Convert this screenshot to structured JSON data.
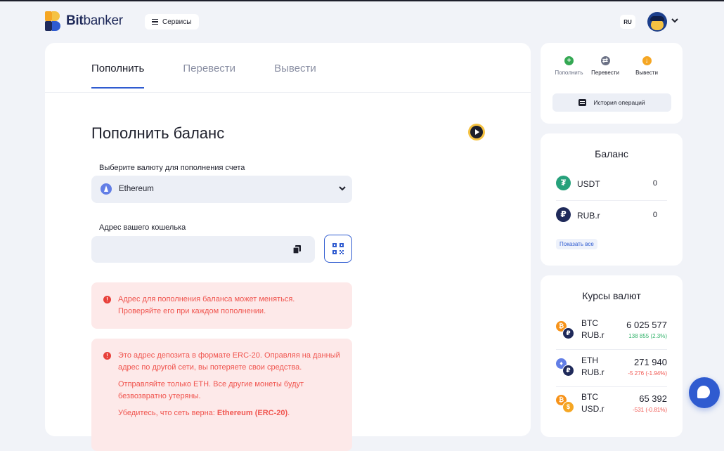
{
  "header": {
    "logo_text_bold": "Bit",
    "logo_text_rest": "banker",
    "services_label": "Сервисы",
    "language": "RU"
  },
  "tabs": [
    {
      "label": "Пополнить",
      "active": true
    },
    {
      "label": "Перевести",
      "active": false
    },
    {
      "label": "Вывести",
      "active": false
    }
  ],
  "deposit": {
    "title": "Пополнить баланс",
    "currency_label": "Выберите валюту для пополнения счета",
    "currency_value": "Ethereum",
    "wallet_label": "Адрес вашего кошелька",
    "wallet_value": ""
  },
  "alerts": {
    "first": {
      "line1": "Адрес для пополнения баланса может меняться.",
      "line2": "Проверяйте его при каждом пополнении."
    },
    "second": {
      "p1": "Это адрес депозита в формате ERC-20. Оправляя на данный адрес по другой сети, вы потеряете свои средства.",
      "p2": "Отправляйте только ETH. Все другие монеты будут безвозвратно утеряны.",
      "p3_prefix": "Убедитесь, что сеть верна: ",
      "p3_bold": "Ethereum (ERC-20)",
      "p3_suffix": "."
    }
  },
  "quick_actions": {
    "deposit": "Пополнить",
    "transfer": "Перевести",
    "withdraw": "Вывести",
    "history": "История операций"
  },
  "balance": {
    "title": "Баланс",
    "items": [
      {
        "name": "USDT",
        "amount": "0"
      },
      {
        "name": "RUB.r",
        "amount": "0"
      }
    ],
    "show_all": "Показать все"
  },
  "rates": {
    "title": "Курсы валют",
    "items": [
      {
        "base": "BTC",
        "quote": "RUB.r",
        "price": "6 025 577",
        "change": "138 855 (2.3%)",
        "direction": "up"
      },
      {
        "base": "ETH",
        "quote": "RUB.r",
        "price": "271 940",
        "change": "-5 276 (-1.94%)",
        "direction": "down"
      },
      {
        "base": "BTC",
        "quote": "USD.r",
        "price": "65 392",
        "change": "-531 (-0.81%)",
        "direction": "down"
      }
    ]
  },
  "colors": {
    "accent": "#2f5bd0",
    "alert_bg": "#fde9e9",
    "alert_text": "#f0554f",
    "positive": "#33b36b",
    "brand_yellow": "#f5c242"
  }
}
